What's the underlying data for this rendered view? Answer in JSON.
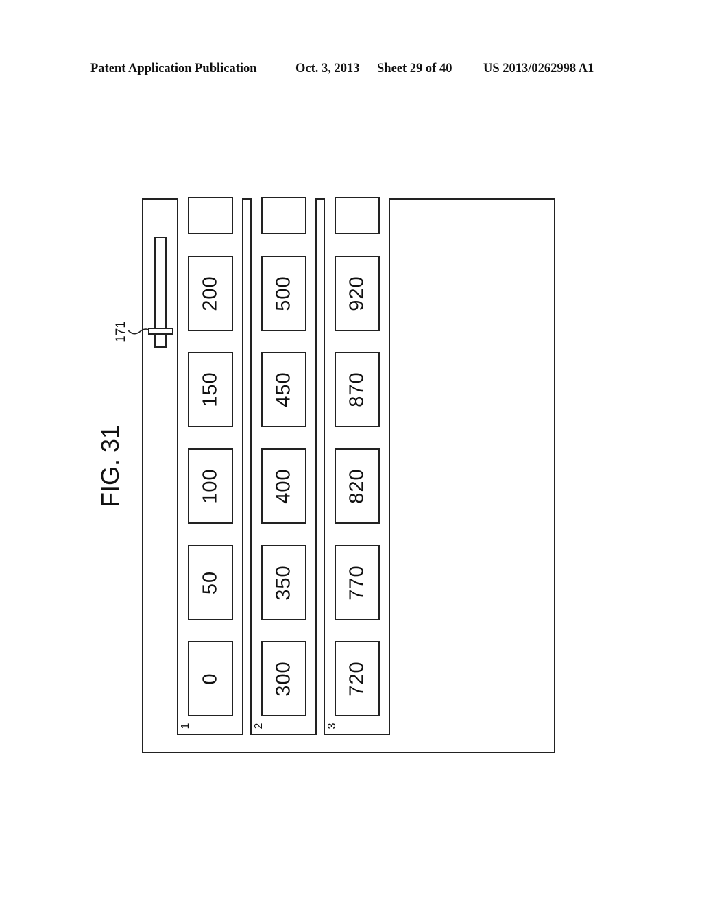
{
  "header": {
    "left": "Patent Application Publication",
    "date": "Oct. 3, 2013",
    "sheet": "Sheet 29 of 40",
    "number": "US 2013/0262998 A1"
  },
  "figure": {
    "title": "FIG. 31",
    "slider_ref": "171",
    "slider_icon": "vertical-slider-icon"
  },
  "strips": [
    {
      "label": "1",
      "cells": [
        "200",
        "150",
        "100",
        "50",
        "0"
      ]
    },
    {
      "label": "2",
      "cells": [
        "500",
        "450",
        "400",
        "350",
        "300"
      ]
    },
    {
      "label": "3",
      "cells": [
        "920",
        "870",
        "820",
        "770",
        "720"
      ]
    }
  ]
}
